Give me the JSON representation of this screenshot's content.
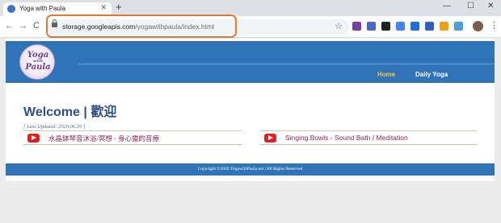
{
  "browser": {
    "tab_title": "Yoga with Paula",
    "tab_close": "✕",
    "new_tab": "+",
    "window_controls": [
      "—",
      "☐",
      "✕"
    ],
    "nav": {
      "back": "←",
      "forward": "→",
      "reload": "C"
    },
    "url_host": "storage.googleapis.com",
    "url_path": "/yogawithpaula/index.html",
    "bookmark_star": "☆",
    "menu": "⋮",
    "extension_icons": [
      {
        "name": "cast-icon",
        "color": "#7b3fa0"
      },
      {
        "name": "reader-icon",
        "color": "#4a67c9"
      },
      {
        "name": "text-size-icon",
        "color": "#202124"
      },
      {
        "name": "translate-icon",
        "color": "#4285f4"
      },
      {
        "name": "puzzle-icon",
        "color": "#1f6ed8"
      },
      {
        "name": "counter-icon",
        "color": "#2d5fc5"
      },
      {
        "name": "star-extension-icon",
        "color": "#e9a21a"
      },
      {
        "name": "layers-icon",
        "color": "#4aa0d6"
      }
    ]
  },
  "site": {
    "logo_line1": "Yoga",
    "logo_line2": "with",
    "logo_line3": "Paula",
    "nav": {
      "home": "Home",
      "daily_yoga": "Daily Yoga"
    },
    "welcome": "Welcome | 歡迎",
    "last_updated": "[ Last Updated: 2020.06.25 ]",
    "videos": [
      {
        "title": "水晶鉢琴音沐浴/冥想 - 身心靈的音療"
      },
      {
        "title": "Singing Bowls - Sound Bath / Meditation"
      }
    ],
    "footer": "Copyright ©2020 YogawithPaula.net | All Rights Reserved"
  },
  "colors": {
    "header_blue": "#2f73b8",
    "welcome_text": "#2e4f86",
    "nav_active": "#f6c23e",
    "video_link": "#8e2461",
    "youtube_red": "#e02020",
    "url_highlight": "#e8762e"
  }
}
